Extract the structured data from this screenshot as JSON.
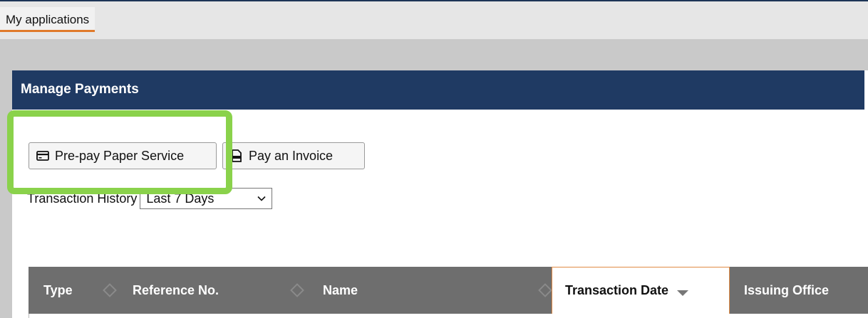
{
  "tabs": [
    {
      "label": "My applications",
      "active": true
    }
  ],
  "panel": {
    "title": "Manage Payments"
  },
  "toolbar": {
    "prepay_label": "Pre-pay Paper Service",
    "prepay_icon": "credit-card-icon",
    "invoice_label": "Pay an Invoice",
    "invoice_icon": "document-icon"
  },
  "history": {
    "label": "Transaction History",
    "selected": "Last 7 Days"
  },
  "table": {
    "columns": [
      {
        "label": "Type",
        "sortable": true
      },
      {
        "label": "Reference No.",
        "sortable": true
      },
      {
        "label": "Name",
        "sortable": true
      },
      {
        "label": "Transaction Date",
        "sortable": true,
        "sorted": "descending"
      },
      {
        "label": "Issuing Office",
        "sortable": true
      }
    ]
  },
  "colors": {
    "header_bg": "#1f3a63",
    "highlight": "#8ad24b",
    "tab_accent": "#e07a2a",
    "table_header_bg": "#6e6e6e"
  }
}
